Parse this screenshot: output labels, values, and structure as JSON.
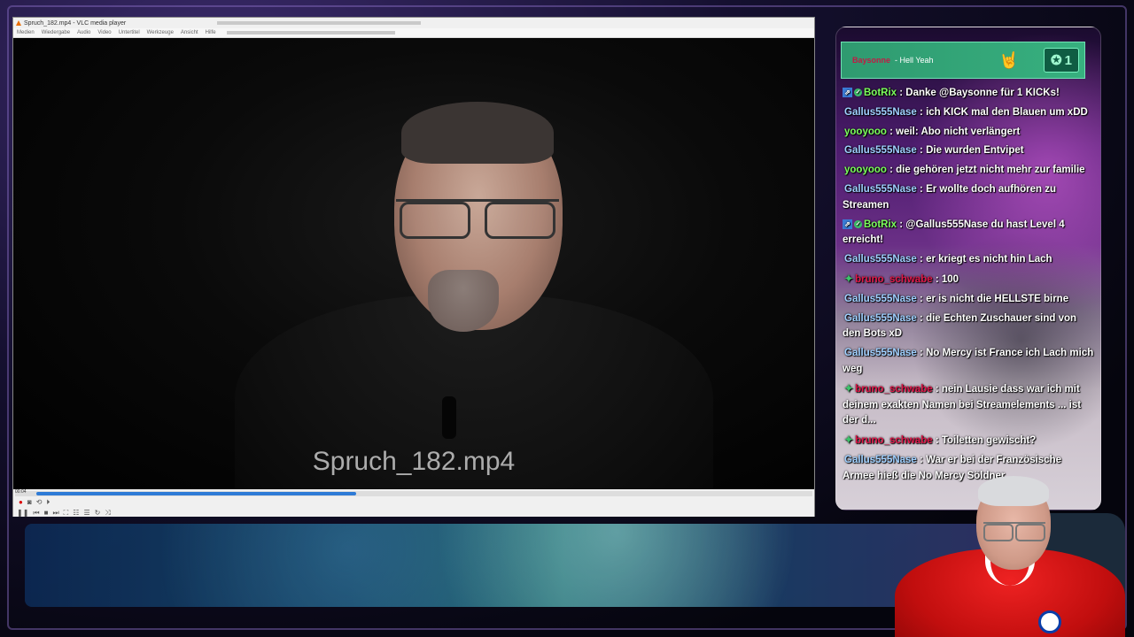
{
  "vlc": {
    "window_title": "Spruch_182.mp4 - VLC media player",
    "menu": [
      "Medien",
      "Wiedergabe",
      "Audio",
      "Video",
      "Untertitel",
      "Werkzeuge",
      "Ansicht",
      "Hilfe"
    ],
    "filename_overlay": "Spruch_182.mp4",
    "elapsed_time": "00:04",
    "progress": 0.42,
    "seek_color": "#2e7bd6"
  },
  "alert": {
    "user": "Baysonne",
    "message": "- Hell Yeah",
    "count": "1",
    "user_color": "#c21a45"
  },
  "chat": {
    "messages": [
      {
        "badges": [
          "bot",
          "verified"
        ],
        "user": "BotRix",
        "user_color": "#7cff5c",
        "text": ": Danke @Baysonne für 1 KICKs!"
      },
      {
        "badges": [],
        "user": "Gallus555Nase",
        "user_color": "#9fd0ff",
        "text": ": ich KICK mal den Blauen um xDD"
      },
      {
        "badges": [],
        "user": "yooyooo",
        "user_color": "#7cff5c",
        "text": ": weil: Abo nicht verlängert"
      },
      {
        "badges": [],
        "user": "Gallus555Nase",
        "user_color": "#9fd0ff",
        "text": ": Die wurden Entvipet"
      },
      {
        "badges": [],
        "user": "yooyooo",
        "user_color": "#7cff5c",
        "text": ": die gehören jetzt nicht mehr zur familie"
      },
      {
        "badges": [],
        "user": "Gallus555Nase",
        "user_color": "#9fd0ff",
        "text": ": Er wollte doch aufhören zu Streamen"
      },
      {
        "badges": [
          "bot",
          "verified"
        ],
        "user": "BotRix",
        "user_color": "#7cff5c",
        "text": ": @Gallus555Nase du hast Level 4 erreicht!"
      },
      {
        "badges": [],
        "user": "Gallus555Nase",
        "user_color": "#9fd0ff",
        "text": ": er kriegt es nicht hin Lach"
      },
      {
        "badges": [
          "sub"
        ],
        "user": "bruno_schwabe",
        "user_color": "#e0184a",
        "text": ": 100"
      },
      {
        "badges": [],
        "user": "Gallus555Nase",
        "user_color": "#9fd0ff",
        "text": ": er is nicht die HELLSTE birne"
      },
      {
        "badges": [],
        "user": "Gallus555Nase",
        "user_color": "#9fd0ff",
        "text": ": die Echten Zuschauer sind von den Bots xD"
      },
      {
        "badges": [],
        "user": "Gallus555Nase",
        "user_color": "#9fd0ff",
        "text": ": No Mercy ist France ich Lach mich weg"
      },
      {
        "badges": [
          "sub"
        ],
        "user": "bruno_schwabe",
        "user_color": "#e0184a",
        "text": ": nein Lausie dass war ich mit deinem exakten Namen bei Streamelements ... ist der d..."
      },
      {
        "badges": [
          "sub"
        ],
        "user": "bruno_schwabe",
        "user_color": "#e0184a",
        "text": ": Toiletten gewischt?"
      },
      {
        "badges": [],
        "user": "Gallus555Nase",
        "user_color": "#9fd0ff",
        "text": ": War er bei der Französische Armee hieß die No Mercy Söldner"
      }
    ]
  }
}
